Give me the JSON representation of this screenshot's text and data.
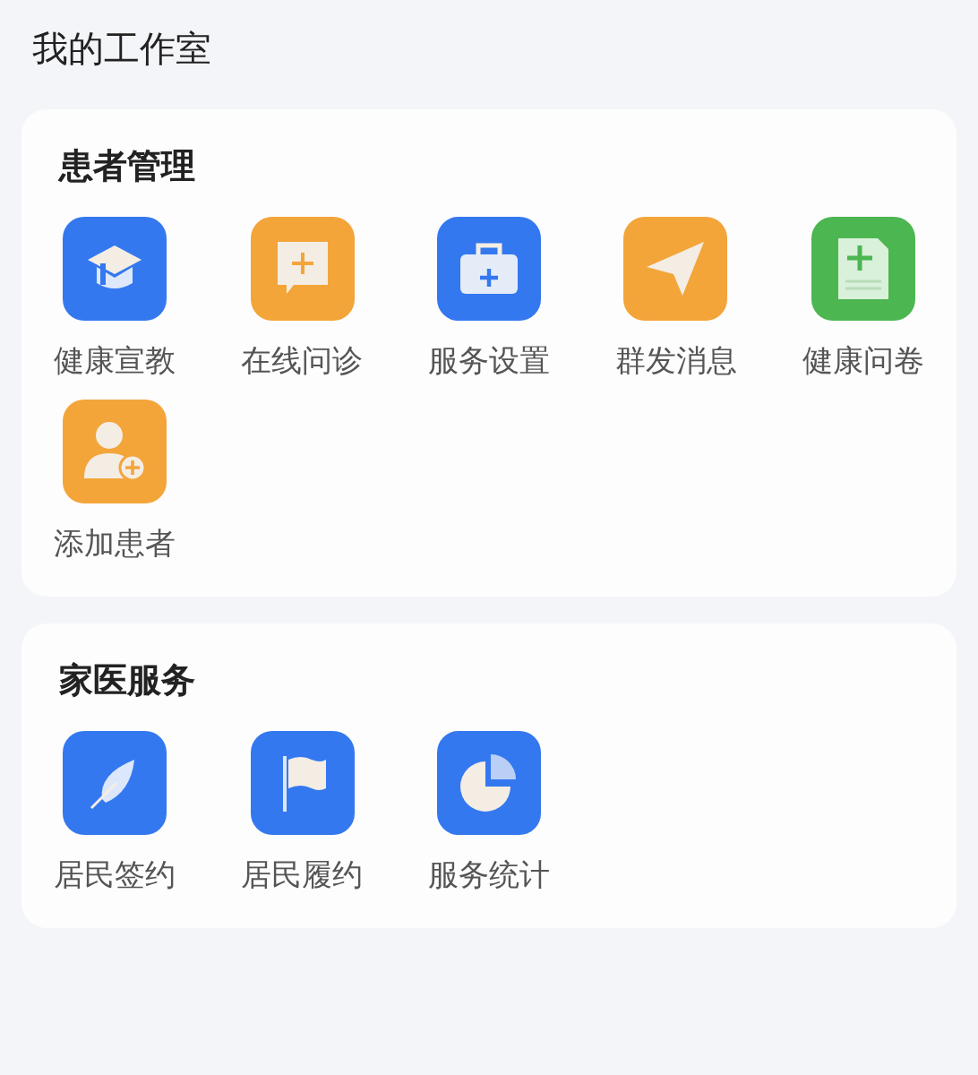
{
  "title": "我的工作室",
  "sections": [
    {
      "title": "患者管理",
      "items": [
        {
          "label": "健康宣教",
          "color": "#3478f0"
        },
        {
          "label": "在线问诊",
          "color": "#f3a53a"
        },
        {
          "label": "服务设置",
          "color": "#3478f0"
        },
        {
          "label": "群发消息",
          "color": "#f3a53a"
        },
        {
          "label": "健康问卷",
          "color": "#4cb650"
        },
        {
          "label": "添加患者",
          "color": "#f3a53a"
        }
      ]
    },
    {
      "title": "家医服务",
      "items": [
        {
          "label": "居民签约",
          "color": "#3478f0"
        },
        {
          "label": "居民履约",
          "color": "#3478f0"
        },
        {
          "label": "服务统计",
          "color": "#3478f0"
        }
      ]
    }
  ]
}
